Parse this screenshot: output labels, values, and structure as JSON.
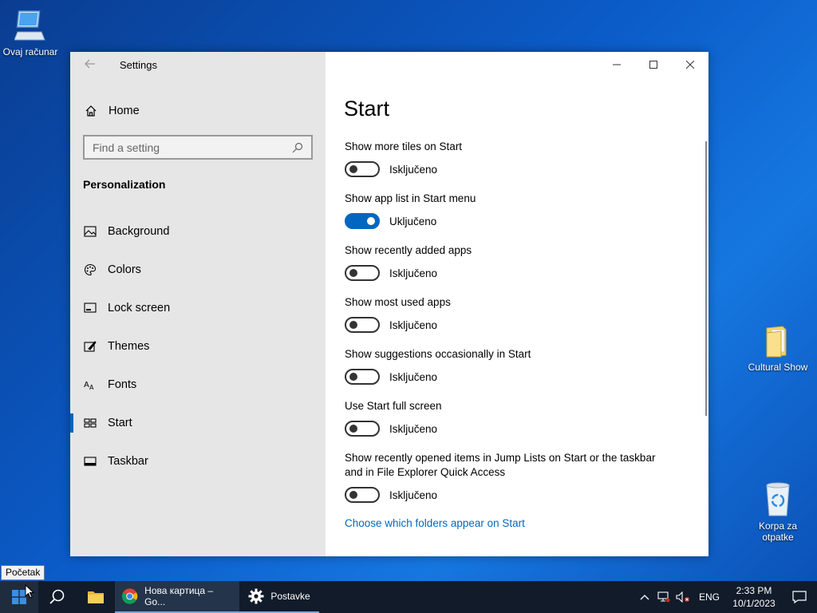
{
  "desktop": {
    "icons": [
      {
        "label": "Ovaj računar"
      },
      {
        "label": "Cultural Show"
      },
      {
        "label": "Korpa za otpatke"
      }
    ]
  },
  "window": {
    "title": "Settings",
    "sidebar": {
      "home_label": "Home",
      "search_placeholder": "Find a setting",
      "section_title": "Personalization",
      "items": [
        {
          "label": "Background",
          "icon": "image-icon"
        },
        {
          "label": "Colors",
          "icon": "palette-icon"
        },
        {
          "label": "Lock screen",
          "icon": "lock-screen-icon"
        },
        {
          "label": "Themes",
          "icon": "themes-icon"
        },
        {
          "label": "Fonts",
          "icon": "fonts-icon"
        },
        {
          "label": "Start",
          "icon": "start-icon",
          "active": true
        },
        {
          "label": "Taskbar",
          "icon": "taskbar-icon"
        }
      ]
    },
    "content": {
      "page_title": "Start",
      "settings": [
        {
          "label": "Show more tiles on Start",
          "state": "Isključeno",
          "on": false
        },
        {
          "label": "Show app list in Start menu",
          "state": "Uključeno",
          "on": true
        },
        {
          "label": "Show recently added apps",
          "state": "Isključeno",
          "on": false
        },
        {
          "label": "Show most used apps",
          "state": "Isključeno",
          "on": false
        },
        {
          "label": "Show suggestions occasionally in Start",
          "state": "Isključeno",
          "on": false
        },
        {
          "label": "Use Start full screen",
          "state": "Isključeno",
          "on": false
        },
        {
          "label": "Show recently opened items in Jump Lists on Start or the taskbar and in File Explorer Quick Access",
          "state": "Isključeno",
          "on": false
        }
      ],
      "link": "Choose which folders appear on Start"
    }
  },
  "tooltip": "Početak",
  "taskbar": {
    "apps": [
      {
        "label": "Нова картица – Go..."
      },
      {
        "label": "Postavke"
      }
    ],
    "language": "ENG",
    "time": "2:33 PM",
    "date": "10/1/2023"
  },
  "colors": {
    "accent": "#0067c0",
    "sidebar_bg": "#e6e6e6",
    "taskbar_bg": "#111b2a"
  }
}
